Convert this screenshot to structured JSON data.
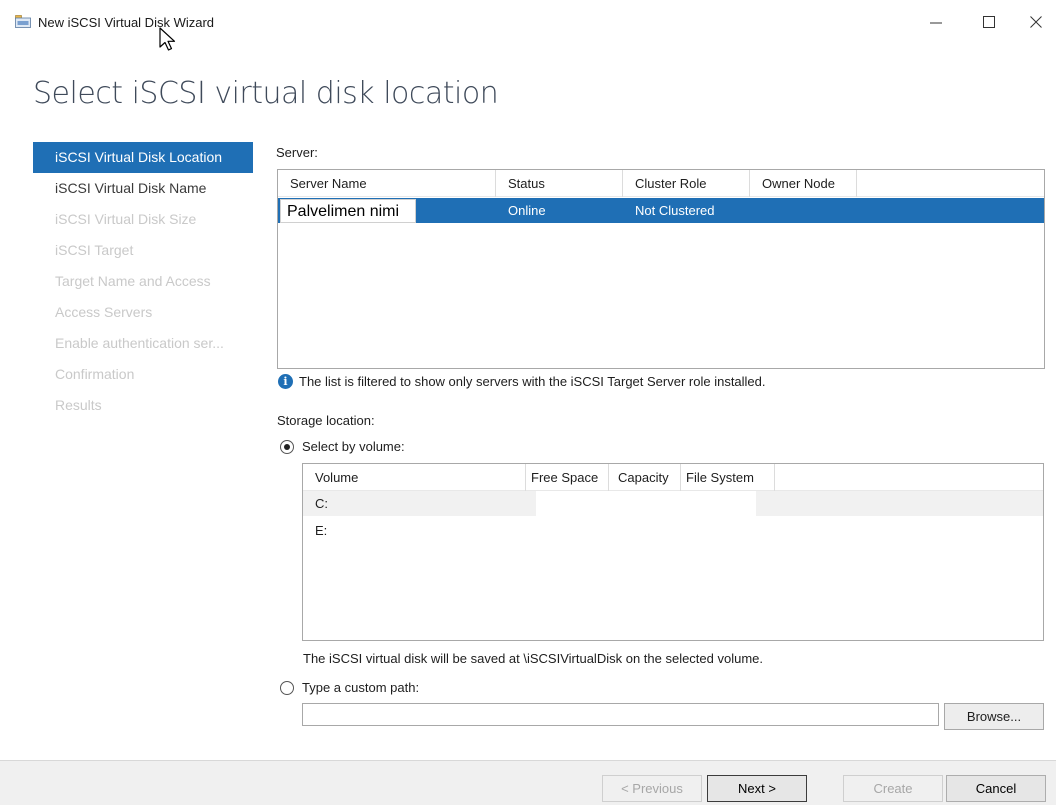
{
  "window": {
    "title": "New iSCSI Virtual Disk Wizard",
    "icons": [
      "disk-wizard-icon",
      "minimize-icon",
      "maximize-icon",
      "close-icon",
      "mouse-pointer-icon"
    ]
  },
  "page": {
    "title": "Select iSCSI virtual disk location"
  },
  "nav": {
    "items": [
      {
        "label": "iSCSI Virtual Disk Location",
        "state": "active"
      },
      {
        "label": "iSCSI Virtual Disk Name",
        "state": "enabled"
      },
      {
        "label": "iSCSI Virtual Disk Size",
        "state": "disabled"
      },
      {
        "label": "iSCSI Target",
        "state": "disabled"
      },
      {
        "label": "Target Name and Access",
        "state": "disabled"
      },
      {
        "label": "Access Servers",
        "state": "disabled"
      },
      {
        "label": "Enable authentication ser...",
        "state": "disabled"
      },
      {
        "label": "Confirmation",
        "state": "disabled"
      },
      {
        "label": "Results",
        "state": "disabled"
      }
    ]
  },
  "server": {
    "label": "Server:",
    "columns": [
      "Server Name",
      "Status",
      "Cluster Role",
      "Owner Node"
    ],
    "rows": [
      {
        "name": "Palvelimen nimi",
        "status": "Online",
        "cluster_role": "Not Clustered",
        "owner_node": ""
      }
    ],
    "info_icon": "info-icon",
    "filter_note": "The list is filtered to show only servers with the iSCSI Target Server role installed."
  },
  "storage": {
    "label": "Storage location:",
    "select_by_volume_label": "Select by volume:",
    "select_by_volume_checked": true,
    "volume_columns": [
      "Volume",
      "Free Space",
      "Capacity",
      "File System"
    ],
    "volumes": [
      {
        "volume": "C:",
        "free_space": "",
        "capacity": "",
        "file_system": ""
      },
      {
        "volume": "E:",
        "free_space": "",
        "capacity": "",
        "file_system": ""
      }
    ],
    "save_note": "The iSCSI virtual disk will be saved at \\iSCSIVirtualDisk on the selected volume.",
    "custom_path_label": "Type a custom path:",
    "custom_path_checked": false,
    "custom_path_value": "",
    "browse_label": "Browse..."
  },
  "footer": {
    "previous_label": "< Previous",
    "next_label": "Next >",
    "create_label": "Create",
    "cancel_label": "Cancel"
  },
  "colors": {
    "accent": "#1f6fb5",
    "footer_bg": "#f0f0f0",
    "title_text": "#3f4a5a"
  }
}
